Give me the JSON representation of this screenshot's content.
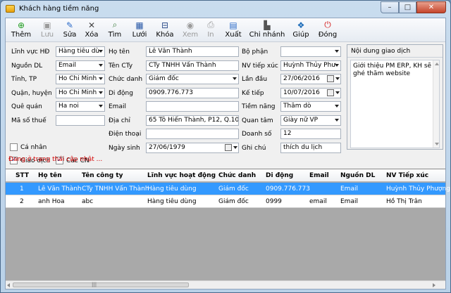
{
  "window": {
    "title": "Khách hàng tiềm năng",
    "controls": {
      "minimize": "–",
      "maximize": "□",
      "close": "✕"
    }
  },
  "toolbar": [
    {
      "label": "Thêm",
      "icon": "add-icon",
      "glyph": "⊕",
      "color": "#1a9a1a",
      "enabled": true
    },
    {
      "label": "Lưu",
      "icon": "save-icon",
      "glyph": "▣",
      "color": "#8a8a8a",
      "enabled": false
    },
    {
      "label": "Sửa",
      "icon": "edit-icon",
      "glyph": "✎",
      "color": "#2a6ac8",
      "enabled": true
    },
    {
      "label": "Xóa",
      "icon": "delete-icon",
      "glyph": "✕",
      "color": "#444444",
      "enabled": true
    },
    {
      "label": "Tìm",
      "icon": "find-icon",
      "glyph": "⌕",
      "color": "#3a7a3a",
      "enabled": true
    },
    {
      "label": "Lưới",
      "icon": "grid-icon",
      "glyph": "▦",
      "color": "#2a5aa8",
      "enabled": true
    },
    {
      "label": "Khóa",
      "icon": "lock-icon",
      "glyph": "⊟",
      "color": "#2a4a88",
      "enabled": true
    },
    {
      "label": "Xem",
      "icon": "view-icon",
      "glyph": "◉",
      "color": "#9a9a9a",
      "enabled": false
    },
    {
      "label": "In",
      "icon": "print-icon",
      "glyph": "⎙",
      "color": "#9a9a9a",
      "enabled": false
    },
    {
      "label": "Xuất",
      "icon": "export-icon",
      "glyph": "▤",
      "color": "#2a6ac8",
      "enabled": true
    },
    {
      "label": "Chi nhánh",
      "icon": "branch-icon",
      "glyph": "▙",
      "color": "#555555",
      "enabled": true
    },
    {
      "label": "Giúp",
      "icon": "help-icon",
      "glyph": "❖",
      "color": "#1a6ab8",
      "enabled": true
    },
    {
      "label": "Đóng",
      "icon": "close-power-icon",
      "glyph": "⏻",
      "color": "#d42020",
      "enabled": true
    }
  ],
  "form": {
    "col1": [
      {
        "label": "Lĩnh vực HĐ",
        "value": "Hàng tiêu dù",
        "type": "dropdown"
      },
      {
        "label": "Nguồn DL",
        "value": "Email",
        "type": "dropdown"
      },
      {
        "label": "Tỉnh, TP",
        "value": "Ho Chi Minh",
        "type": "dropdown"
      },
      {
        "label": "Quận, huyện",
        "value": "Ho Chi Minh",
        "type": "dropdown"
      },
      {
        "label": "Quê quán",
        "value": "Ha noi",
        "type": "dropdown"
      },
      {
        "label": "Mã số thuế",
        "value": "",
        "type": "text"
      }
    ],
    "checkboxes": [
      {
        "label": "Cá nhân",
        "checked": false
      },
      {
        "label": "Giao dịch",
        "checked": true
      },
      {
        "label": "Các CN",
        "checked": true
      }
    ],
    "col2": [
      {
        "label": "Họ tên",
        "value": "Lê Văn Thành",
        "type": "text"
      },
      {
        "label": "Tên CTy",
        "value": "CTy TNHH Vấn Thành",
        "type": "text"
      },
      {
        "label": "Chức danh",
        "value": "Giám đốc",
        "type": "dropdown"
      },
      {
        "label": "Di động",
        "value": "0909.776.773",
        "type": "text"
      },
      {
        "label": "Email",
        "value": "",
        "type": "text"
      },
      {
        "label": "Địa chỉ",
        "value": "65 Tô Hiến Thành, P12, Q.10",
        "type": "text"
      },
      {
        "label": "Điện thoại",
        "value": "",
        "type": "text"
      },
      {
        "label": "Ngày sinh",
        "value": "27/06/1979",
        "type": "date"
      }
    ],
    "col3": [
      {
        "label": "Bộ phận",
        "value": "",
        "type": "dropdown"
      },
      {
        "label": "NV tiếp xúc",
        "value": "Huỳnh Thủy Phư",
        "type": "dropdown"
      },
      {
        "label": "Lần đầu",
        "value": "27/06/2016",
        "type": "date"
      },
      {
        "label": "Kế tiếp",
        "value": "10/07/2016",
        "type": "date"
      },
      {
        "label": "Tiềm năng",
        "value": "Thăm dò",
        "type": "dropdown"
      },
      {
        "label": "Quan tâm",
        "value": "Giày nữ VP",
        "type": "dropdown"
      },
      {
        "label": "Doanh số",
        "value": "12",
        "type": "text"
      },
      {
        "label": "Ghi chú",
        "value": "thích du lịch",
        "type": "text"
      }
    ],
    "notes": {
      "header": "Nội dung giao dịch",
      "body": "Giới thiệu PM ERP, KH sẽ ghé thăm website"
    }
  },
  "status": "Đang ở trạng thái cập nhật ...",
  "grid": {
    "columns": [
      "STT",
      "Họ tên",
      "Tên công ty",
      "Lĩnh vực hoạt động",
      "Chức danh",
      "Di động",
      "Email",
      "Nguồn DL",
      "NV Tiếp xúc"
    ],
    "rows": [
      [
        "1",
        "Lê Văn Thành",
        "CTy TNHH Vấn Thành",
        "Hàng tiêu dùng",
        "Giám đốc",
        "0909.776.773",
        "",
        "Email",
        "Huỳnh Thủy Phượng"
      ],
      [
        "2",
        "anh Hoa",
        "abc",
        "Hàng tiêu dùng",
        "Giám đốc",
        "0999",
        "email",
        "Email",
        "Hồ Thị Trân"
      ]
    ],
    "selected_row": 0,
    "hscroll_grip": "|||"
  }
}
